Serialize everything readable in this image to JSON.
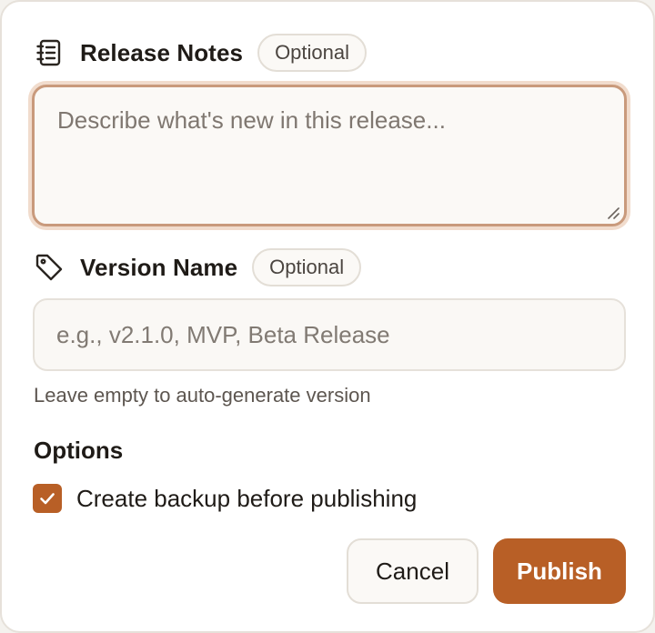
{
  "release_notes": {
    "title": "Release Notes",
    "badge": "Optional",
    "icon": "notebook-icon",
    "placeholder": "Describe what's new in this release...",
    "value": ""
  },
  "version_name": {
    "title": "Version Name",
    "badge": "Optional",
    "icon": "tag-icon",
    "placeholder": "e.g., v2.1.0, MVP, Beta Release",
    "value": "",
    "helper": "Leave empty to auto-generate version"
  },
  "options": {
    "title": "Options",
    "create_backup": {
      "label": "Create backup before publishing",
      "checked": true
    }
  },
  "actions": {
    "cancel_label": "Cancel",
    "publish_label": "Publish"
  },
  "colors": {
    "accent": "#b85f26",
    "focus_ring": "#c99a7c",
    "border": "#e6e1da",
    "text": "#1f1b17"
  }
}
